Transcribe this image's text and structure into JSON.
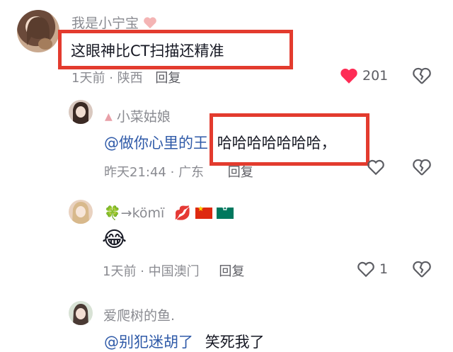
{
  "comments": [
    {
      "username": "我是小宁宝",
      "text": "这眼神比CT扫描还精准",
      "time": "1天前",
      "location": "陕西",
      "reply_label": "回复",
      "likes": "201",
      "liked": true
    },
    {
      "username": "小菜姑娘",
      "mention": "@做你心里的王",
      "text": "哈哈哈哈哈哈哈，",
      "time": "昨天21:44",
      "location": "广东",
      "reply_label": "回复",
      "likes": ""
    },
    {
      "username": "🍀→kömï",
      "emoji": "😂",
      "time": "1天前",
      "location": "中国澳门",
      "reply_label": "回复",
      "likes": "1"
    },
    {
      "username": "爱爬树的鱼.",
      "mention": "@别犯迷胡了",
      "text": "笑死我了"
    }
  ],
  "colors": {
    "highlight_box": "#e33b2e",
    "like_red": "#fe2c55",
    "mention_blue": "#2f5aa8"
  }
}
